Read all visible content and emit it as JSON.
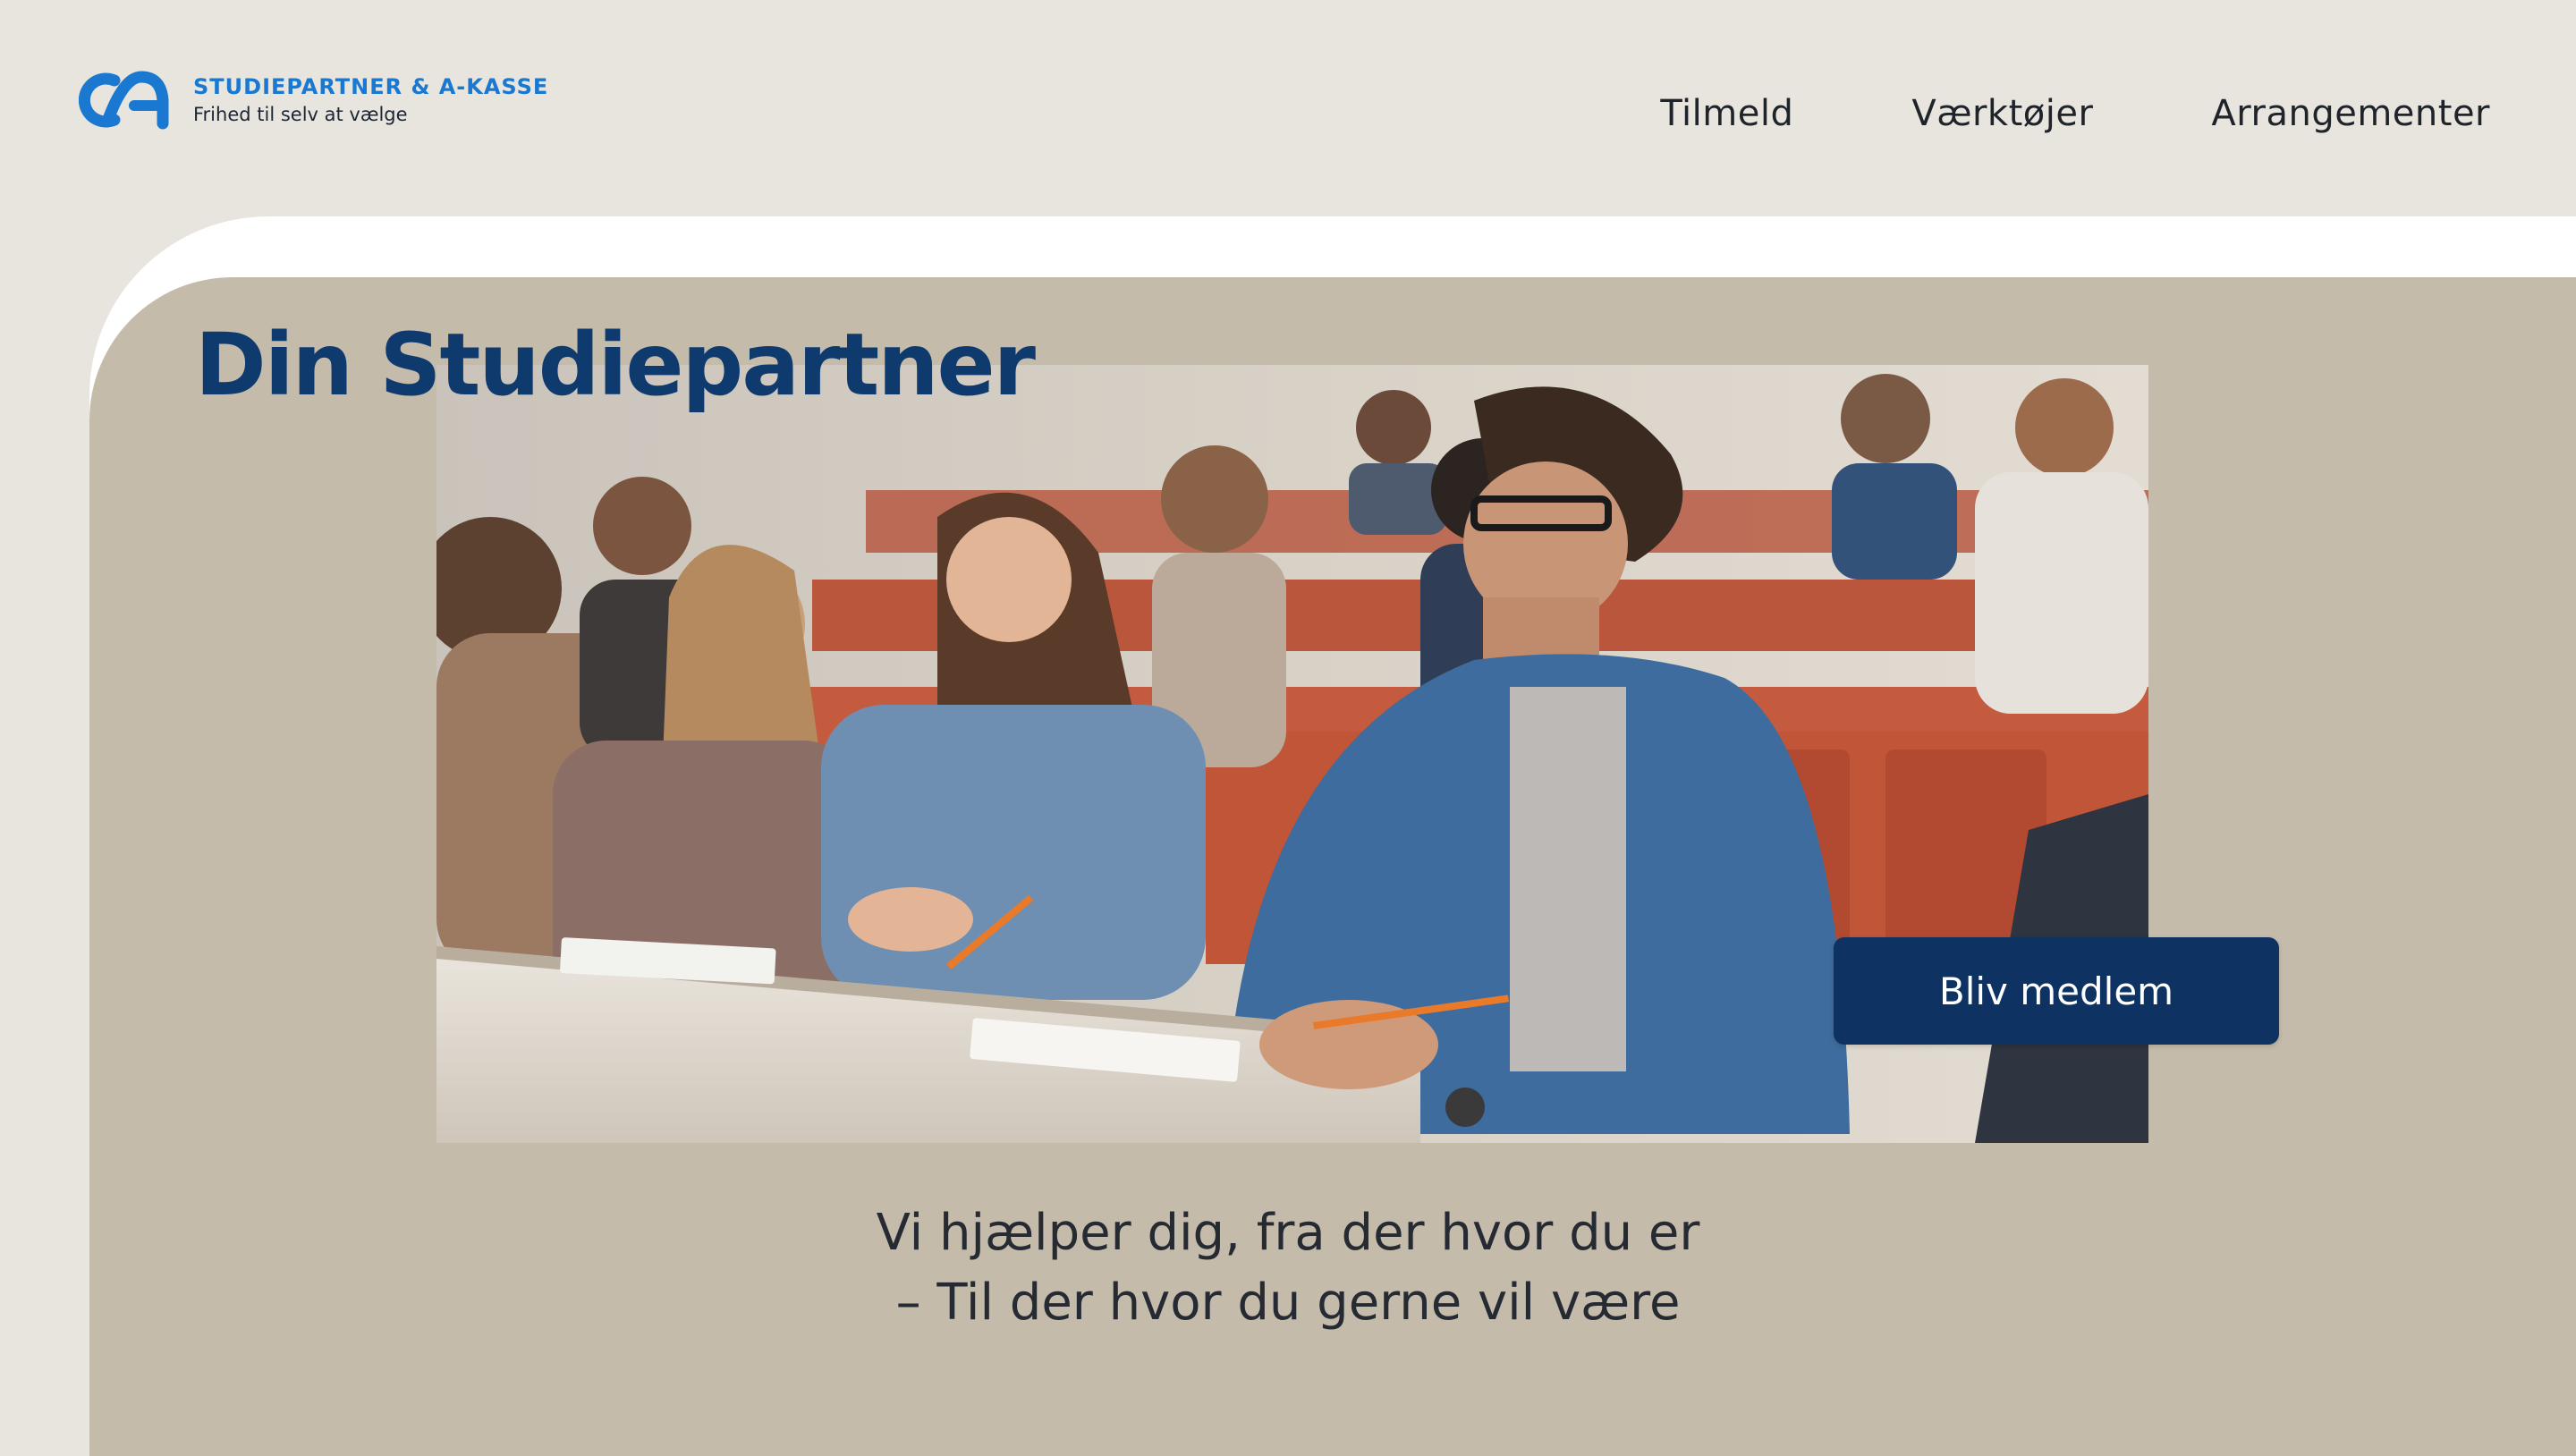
{
  "header": {
    "logo": {
      "title": "STUDIEPARTNER & A-KASSE",
      "tagline": "Frihed til selv at vælge",
      "icon": "ca-logo-icon",
      "color": "#1A78D0"
    },
    "nav": [
      {
        "label": "Tilmeld"
      },
      {
        "label": "Værktøjer"
      },
      {
        "label": "Arrangementer"
      }
    ]
  },
  "hero": {
    "title": "Din Studiepartner",
    "image": "lecture-hall-students-photo",
    "cta_label": "Bliv medlem",
    "subtitle_line1": "Vi hjælper dig, fra der hvor du er",
    "subtitle_line2": "– Til der hvor du gerne vil være"
  },
  "colors": {
    "page_bg": "#E7E5DE",
    "panel_bg": "#C5BBAB",
    "title_navy": "#0E3A6E",
    "button_navy": "#0E3362",
    "brand_blue": "#1A78D0"
  }
}
